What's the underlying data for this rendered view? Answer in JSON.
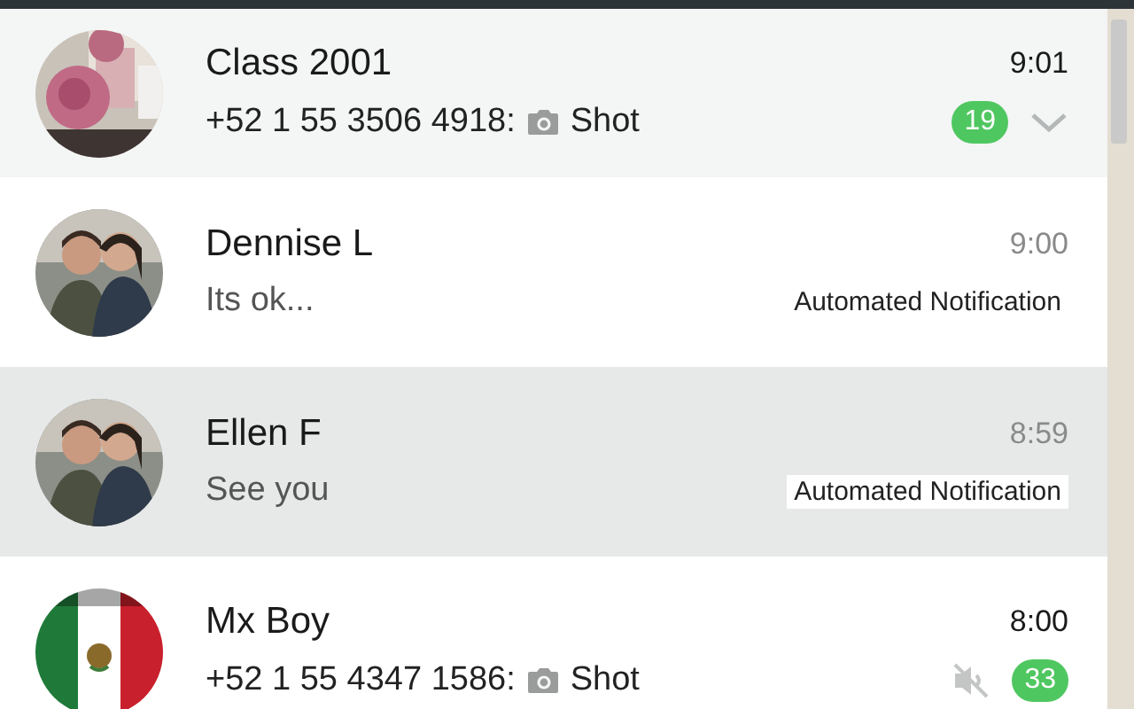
{
  "chats": [
    {
      "name": "Class 2001",
      "time": "9:01",
      "sender": "+52 1 55 3506 4918:",
      "has_photo": true,
      "message": "Shot",
      "unread_count": "19",
      "muted": false,
      "hovered": true,
      "selected": false
    },
    {
      "name": "Dennise L",
      "time": "9:00",
      "message": "Its ok...",
      "label": "Automated Notification",
      "muted": false,
      "hovered": false,
      "selected": false
    },
    {
      "name": "Ellen F",
      "time": "8:59",
      "message": "See you",
      "label": "Automated Notification",
      "muted": false,
      "hovered": false,
      "selected": true
    },
    {
      "name": "Mx Boy",
      "time": "8:00",
      "sender": "+52 1 55 4347 1586:",
      "has_photo": true,
      "message": "Shot",
      "unread_count": "33",
      "muted": true,
      "hovered": false,
      "selected": false
    }
  ]
}
